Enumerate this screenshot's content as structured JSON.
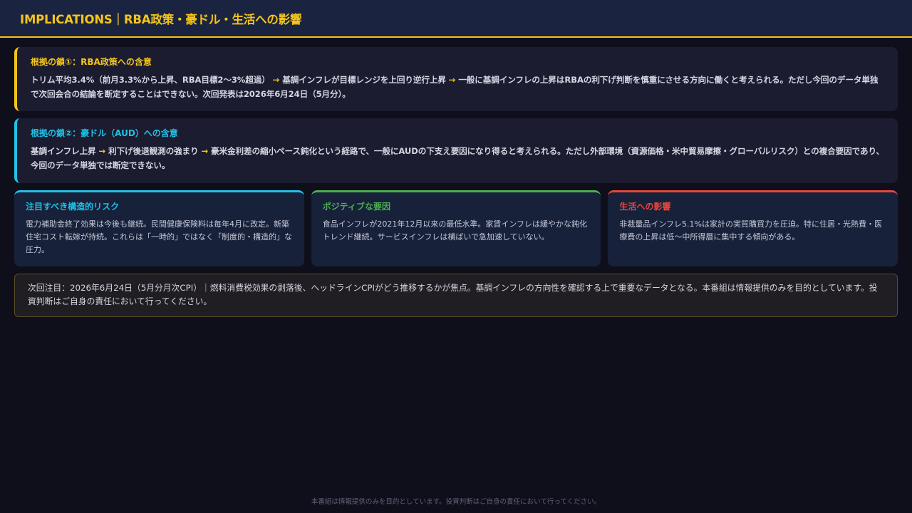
{
  "header": {
    "title": "IMPLICATIONS｜RBA政策・豪ドル・生活への影響"
  },
  "panel1": {
    "title": "根拠の鎖①：RBA政策への含意",
    "seg1": "トリム平均3.4%（前月3.3%から上昇、RBA目標2〜3%超過）",
    "arrow1": "→",
    "seg2": "基調インフレが目標レンジを上回り逆行上昇",
    "arrow2": "→",
    "seg3": "一般に基調インフレの上昇はRBAの利下げ判断を慎重にさせる方向に働くと考えられる。ただし今回のデータ単独で次回会合の結論を断定することはできない。次回発表は2026年6月24日（5月分）。"
  },
  "panel2": {
    "title": "根拠の鎖②：豪ドル（AUD）への含意",
    "seg1": "基調インフレ上昇",
    "arrow1": "→",
    "seg2": "利下げ後退観測の強まり",
    "arrow2": "→",
    "seg3": "豪米金利差の縮小ペース鈍化という経路で、一般にAUDの下支え要因になり得ると考えられる。ただし外部環境（資源価格・米中貿易摩擦・グローバルリスク）との複合要因であり、今回のデータ単独では断定できない。"
  },
  "cards": [
    {
      "title": "注目すべき構造的リスク",
      "body": "電力補助金終了効果は今後も継続。民間健康保険料は毎年4月に改定。新築住宅コスト転嫁が持続。これらは「一時的」ではなく「制度的・構造的」な圧力。"
    },
    {
      "title": "ポジティブな要因",
      "body": "食品インフレが2021年12月以来の最低水準。家賃インフレは緩やかな鈍化トレンド継続。サービスインフレは横ばいで急加速していない。"
    },
    {
      "title": "生活への影響",
      "body": "非裁量品インフレ5.1%は家計の実質購買力を圧迫。特に住居・光熱費・医療費の上昇は低〜中所得層に集中する傾向がある。"
    }
  ],
  "note": {
    "text": "次回注目：2026年6月24日（5月分月次CPI）｜燃料消費税効果の剥落後、ヘッドラインCPIがどう推移するかが焦点。基調インフレの方向性を確認する上で重要なデータとなる。本番組は情報提供のみを目的としています。投資判断はご自身の責任において行ってください。"
  },
  "footer": {
    "text": "本番組は情報提供のみを目的としています。投資判断はご自身の責任において行ってください。"
  },
  "colors": {
    "accent_gold": "#f5c518",
    "accent_cyan": "#22c1e6",
    "accent_green": "#4caf50",
    "accent_red": "#e8453c"
  }
}
